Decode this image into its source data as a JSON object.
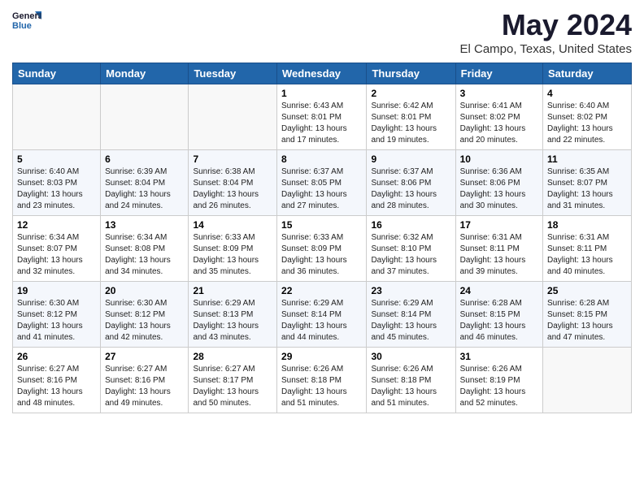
{
  "header": {
    "logo_general": "General",
    "logo_blue": "Blue",
    "title": "May 2024",
    "subtitle": "El Campo, Texas, United States"
  },
  "weekdays": [
    "Sunday",
    "Monday",
    "Tuesday",
    "Wednesday",
    "Thursday",
    "Friday",
    "Saturday"
  ],
  "weeks": [
    [
      {
        "num": "",
        "info": ""
      },
      {
        "num": "",
        "info": ""
      },
      {
        "num": "",
        "info": ""
      },
      {
        "num": "1",
        "info": "Sunrise: 6:43 AM\nSunset: 8:01 PM\nDaylight: 13 hours and 17 minutes."
      },
      {
        "num": "2",
        "info": "Sunrise: 6:42 AM\nSunset: 8:01 PM\nDaylight: 13 hours and 19 minutes."
      },
      {
        "num": "3",
        "info": "Sunrise: 6:41 AM\nSunset: 8:02 PM\nDaylight: 13 hours and 20 minutes."
      },
      {
        "num": "4",
        "info": "Sunrise: 6:40 AM\nSunset: 8:02 PM\nDaylight: 13 hours and 22 minutes."
      }
    ],
    [
      {
        "num": "5",
        "info": "Sunrise: 6:40 AM\nSunset: 8:03 PM\nDaylight: 13 hours and 23 minutes."
      },
      {
        "num": "6",
        "info": "Sunrise: 6:39 AM\nSunset: 8:04 PM\nDaylight: 13 hours and 24 minutes."
      },
      {
        "num": "7",
        "info": "Sunrise: 6:38 AM\nSunset: 8:04 PM\nDaylight: 13 hours and 26 minutes."
      },
      {
        "num": "8",
        "info": "Sunrise: 6:37 AM\nSunset: 8:05 PM\nDaylight: 13 hours and 27 minutes."
      },
      {
        "num": "9",
        "info": "Sunrise: 6:37 AM\nSunset: 8:06 PM\nDaylight: 13 hours and 28 minutes."
      },
      {
        "num": "10",
        "info": "Sunrise: 6:36 AM\nSunset: 8:06 PM\nDaylight: 13 hours and 30 minutes."
      },
      {
        "num": "11",
        "info": "Sunrise: 6:35 AM\nSunset: 8:07 PM\nDaylight: 13 hours and 31 minutes."
      }
    ],
    [
      {
        "num": "12",
        "info": "Sunrise: 6:34 AM\nSunset: 8:07 PM\nDaylight: 13 hours and 32 minutes."
      },
      {
        "num": "13",
        "info": "Sunrise: 6:34 AM\nSunset: 8:08 PM\nDaylight: 13 hours and 34 minutes."
      },
      {
        "num": "14",
        "info": "Sunrise: 6:33 AM\nSunset: 8:09 PM\nDaylight: 13 hours and 35 minutes."
      },
      {
        "num": "15",
        "info": "Sunrise: 6:33 AM\nSunset: 8:09 PM\nDaylight: 13 hours and 36 minutes."
      },
      {
        "num": "16",
        "info": "Sunrise: 6:32 AM\nSunset: 8:10 PM\nDaylight: 13 hours and 37 minutes."
      },
      {
        "num": "17",
        "info": "Sunrise: 6:31 AM\nSunset: 8:11 PM\nDaylight: 13 hours and 39 minutes."
      },
      {
        "num": "18",
        "info": "Sunrise: 6:31 AM\nSunset: 8:11 PM\nDaylight: 13 hours and 40 minutes."
      }
    ],
    [
      {
        "num": "19",
        "info": "Sunrise: 6:30 AM\nSunset: 8:12 PM\nDaylight: 13 hours and 41 minutes."
      },
      {
        "num": "20",
        "info": "Sunrise: 6:30 AM\nSunset: 8:12 PM\nDaylight: 13 hours and 42 minutes."
      },
      {
        "num": "21",
        "info": "Sunrise: 6:29 AM\nSunset: 8:13 PM\nDaylight: 13 hours and 43 minutes."
      },
      {
        "num": "22",
        "info": "Sunrise: 6:29 AM\nSunset: 8:14 PM\nDaylight: 13 hours and 44 minutes."
      },
      {
        "num": "23",
        "info": "Sunrise: 6:29 AM\nSunset: 8:14 PM\nDaylight: 13 hours and 45 minutes."
      },
      {
        "num": "24",
        "info": "Sunrise: 6:28 AM\nSunset: 8:15 PM\nDaylight: 13 hours and 46 minutes."
      },
      {
        "num": "25",
        "info": "Sunrise: 6:28 AM\nSunset: 8:15 PM\nDaylight: 13 hours and 47 minutes."
      }
    ],
    [
      {
        "num": "26",
        "info": "Sunrise: 6:27 AM\nSunset: 8:16 PM\nDaylight: 13 hours and 48 minutes."
      },
      {
        "num": "27",
        "info": "Sunrise: 6:27 AM\nSunset: 8:16 PM\nDaylight: 13 hours and 49 minutes."
      },
      {
        "num": "28",
        "info": "Sunrise: 6:27 AM\nSunset: 8:17 PM\nDaylight: 13 hours and 50 minutes."
      },
      {
        "num": "29",
        "info": "Sunrise: 6:26 AM\nSunset: 8:18 PM\nDaylight: 13 hours and 51 minutes."
      },
      {
        "num": "30",
        "info": "Sunrise: 6:26 AM\nSunset: 8:18 PM\nDaylight: 13 hours and 51 minutes."
      },
      {
        "num": "31",
        "info": "Sunrise: 6:26 AM\nSunset: 8:19 PM\nDaylight: 13 hours and 52 minutes."
      },
      {
        "num": "",
        "info": ""
      }
    ]
  ]
}
